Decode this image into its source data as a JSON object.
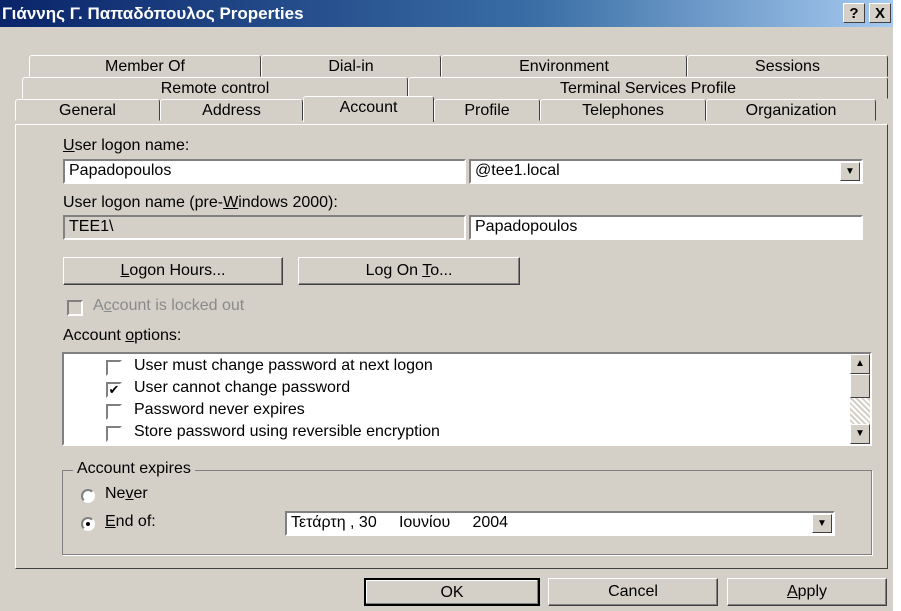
{
  "window": {
    "title": "Γιάννης Γ. Παπαδόπουλος Properties",
    "help_button": "?",
    "close_button": "X"
  },
  "tabs": {
    "row1": [
      "Member Of",
      "Dial-in",
      "Environment",
      "Sessions"
    ],
    "row2": [
      "Remote control",
      "Terminal Services Profile"
    ],
    "row3": [
      "General",
      "Address",
      "Account",
      "Profile",
      "Telephones",
      "Organization"
    ],
    "active": "Account"
  },
  "account": {
    "logon_name_label_pre": "U",
    "logon_name_label_rest": "ser logon name:",
    "logon_name_value": "Papadopoulos",
    "domain_suffix": "@tee1.local",
    "pre2000_label_a": "User logon name (pre-",
    "pre2000_label_u": "W",
    "pre2000_label_b": "indows 2000):",
    "pre2000_domain": "TEE1\\",
    "pre2000_value": "Papadopoulos",
    "logon_hours_u": "L",
    "logon_hours_rest": "ogon Hours...",
    "log_on_to_a": "Log On ",
    "log_on_to_u": "T",
    "log_on_to_b": "o...",
    "locked_out_a": "A",
    "locked_out_u": "c",
    "locked_out_b": "count is locked out",
    "options_label_a": "Account ",
    "options_label_u": "o",
    "options_label_b": "ptions:",
    "options": [
      {
        "label": "User must change password at next logon",
        "checked": false
      },
      {
        "label": "User cannot change password",
        "checked": true
      },
      {
        "label": "Password never expires",
        "checked": false
      },
      {
        "label": "Store password using reversible encryption",
        "checked": false
      }
    ],
    "expires_label": "Account expires",
    "never_a": "Ne",
    "never_u": "v",
    "never_b": "er",
    "end_of_u": "E",
    "end_of_rest": "nd of:",
    "end_date": "Τετάρτη , 30     Ιουνίου     2004"
  },
  "buttons": {
    "ok": "OK",
    "cancel": "Cancel",
    "apply_u": "A",
    "apply_rest": "pply"
  },
  "icons": {
    "check": "✔",
    "combo": "▼",
    "scroll_up": "▲",
    "scroll_down": "▼"
  }
}
